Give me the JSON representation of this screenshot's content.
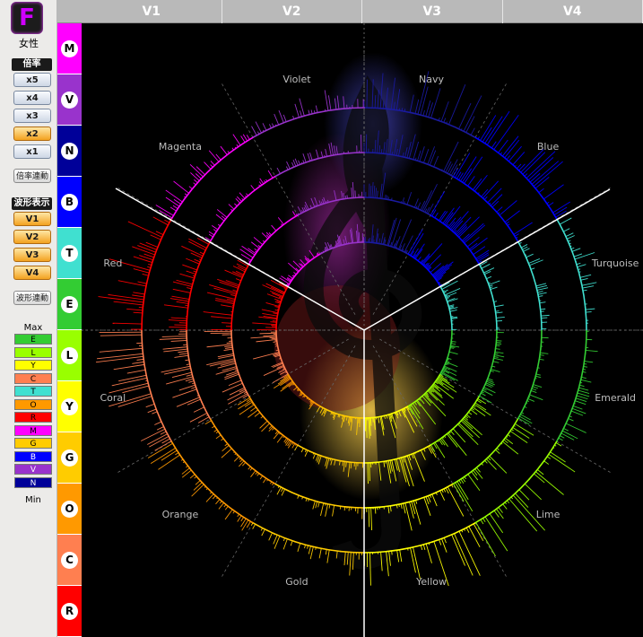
{
  "app": {
    "logo_letter": "F",
    "gender_label": "女性"
  },
  "magnification": {
    "title": "倍率",
    "buttons": [
      {
        "label": "x5",
        "selected": false
      },
      {
        "label": "x4",
        "selected": false
      },
      {
        "label": "x3",
        "selected": false
      },
      {
        "label": "x2",
        "selected": true
      },
      {
        "label": "x1",
        "selected": false
      }
    ],
    "link_label": "倍率連動"
  },
  "waveform": {
    "title": "波形表示",
    "buttons": [
      {
        "label": "V1",
        "selected": true
      },
      {
        "label": "V2",
        "selected": true
      },
      {
        "label": "V3",
        "selected": true
      },
      {
        "label": "V4",
        "selected": true
      }
    ],
    "link_label": "波形連動"
  },
  "legend": {
    "max_label": "Max",
    "min_label": "Min",
    "items": [
      {
        "label": "E",
        "color": "#33cc33"
      },
      {
        "label": "L",
        "color": "#99ff00"
      },
      {
        "label": "Y",
        "color": "#ffff00"
      },
      {
        "label": "C",
        "color": "#ff7f50"
      },
      {
        "label": "T",
        "color": "#40e0d0"
      },
      {
        "label": "O",
        "color": "#ff9900"
      },
      {
        "label": "R",
        "color": "#ff0000"
      },
      {
        "label": "M",
        "color": "#ff00ff"
      },
      {
        "label": "G",
        "color": "#ffcc00"
      },
      {
        "label": "B",
        "color": "#0000ff"
      },
      {
        "label": "V",
        "color": "#9933cc"
      },
      {
        "label": "N",
        "color": "#000099"
      }
    ]
  },
  "bands": [
    {
      "label": "M",
      "color": "#ff00ff"
    },
    {
      "label": "V",
      "color": "#9933cc"
    },
    {
      "label": "N",
      "color": "#000099"
    },
    {
      "label": "B",
      "color": "#0000ff"
    },
    {
      "label": "T",
      "color": "#40e0d0"
    },
    {
      "label": "E",
      "color": "#33cc33"
    },
    {
      "label": "L",
      "color": "#99ff00"
    },
    {
      "label": "Y",
      "color": "#ffff00"
    },
    {
      "label": "G",
      "color": "#ffcc00"
    },
    {
      "label": "O",
      "color": "#ff9900"
    },
    {
      "label": "C",
      "color": "#ff7f50"
    },
    {
      "label": "R",
      "color": "#ff0000"
    }
  ],
  "columns": [
    "V1",
    "V2",
    "V3",
    "V4"
  ],
  "sectors": [
    {
      "name": "Navy",
      "angle": 15,
      "color": "#1a1aa0"
    },
    {
      "name": "Blue",
      "angle": 45,
      "color": "#0000ff"
    },
    {
      "name": "Turquoise",
      "angle": 75,
      "color": "#40e0d0"
    },
    {
      "name": "Emerald",
      "angle": 105,
      "color": "#33cc33"
    },
    {
      "name": "Lime",
      "angle": 135,
      "color": "#99ff00"
    },
    {
      "name": "Yellow",
      "angle": 165,
      "color": "#ffff00"
    },
    {
      "name": "Gold",
      "angle": 195,
      "color": "#ffcc00"
    },
    {
      "name": "Orange",
      "angle": 225,
      "color": "#ff9900"
    },
    {
      "name": "Coral",
      "angle": 255,
      "color": "#ff7f50"
    },
    {
      "name": "Red",
      "angle": 285,
      "color": "#ff0000"
    },
    {
      "name": "Magenta",
      "angle": 315,
      "color": "#ff00ff"
    },
    {
      "name": "Violet",
      "angle": 345,
      "color": "#9933cc"
    }
  ]
}
